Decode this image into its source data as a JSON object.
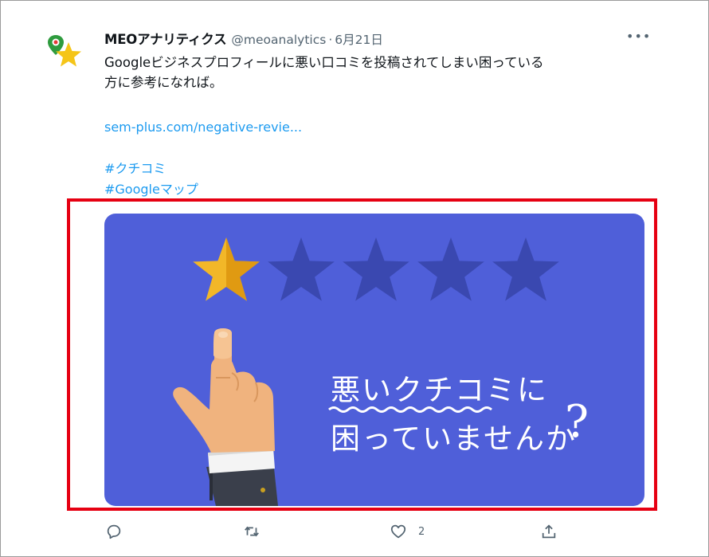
{
  "tweet": {
    "author_name": "MEOアナリティクス",
    "handle": "@meoanalytics",
    "separator": "·",
    "date": "6月21日",
    "more_label": "•••",
    "text_line1": "Googleビジネスプロフィールに悪い口コミを投稿されてしまい困っている",
    "text_line2": "方に参考になれば。",
    "link": "sem-plus.com/negative-revie...",
    "hashtags": [
      "#クチコミ",
      "#Googleマップ"
    ]
  },
  "media": {
    "caption_line1": "悪いクチコミに",
    "caption_line2": "困っていませんか",
    "question_mark": "?",
    "rating": {
      "value": 1,
      "max": 5
    },
    "colors": {
      "background": "#4f5fd9",
      "star_filled": "#f2b728",
      "star_empty": "#3a48b0"
    }
  },
  "actions": {
    "reply_icon": "reply-icon",
    "retweet_icon": "retweet-icon",
    "like_icon": "like-icon",
    "like_count": "2",
    "share_icon": "share-icon"
  },
  "colors": {
    "link": "#1d9bf0",
    "highlight_border": "#e60012",
    "muted": "#536471"
  }
}
